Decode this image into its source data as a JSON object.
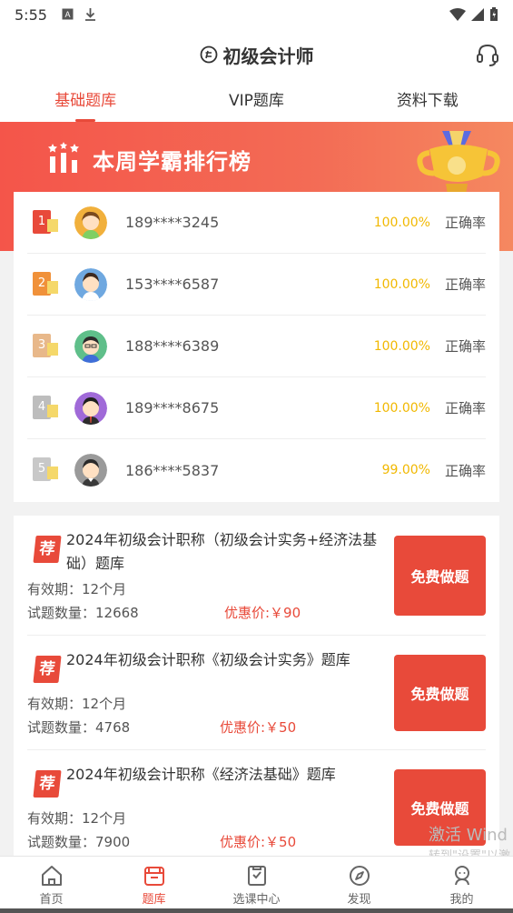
{
  "status": {
    "time": "5:55"
  },
  "header": {
    "title": "初级会计师"
  },
  "tabs": [
    {
      "label": "基础题库"
    },
    {
      "label": "VIP题库"
    },
    {
      "label": "资料下载"
    }
  ],
  "banner": {
    "title": "本周学霸排行榜"
  },
  "leaderboard": [
    {
      "rank": "1",
      "phone": "189****3245",
      "rate": "100.00%",
      "rate_label": "正确率",
      "color": "#e84a3a"
    },
    {
      "rank": "2",
      "phone": "153****6587",
      "rate": "100.00%",
      "rate_label": "正确率",
      "color": "#f0913a"
    },
    {
      "rank": "3",
      "phone": "188****6389",
      "rate": "100.00%",
      "rate_label": "正确率",
      "color": "#e8b88a"
    },
    {
      "rank": "4",
      "phone": "189****8675",
      "rate": "100.00%",
      "rate_label": "正确率",
      "color": "#bdbdbd"
    },
    {
      "rank": "5",
      "phone": "186****5837",
      "rate": "99.00%",
      "rate_label": "正确率",
      "color": "#c8c8c8"
    }
  ],
  "courses": [
    {
      "badge": "荐",
      "title": "2024年初级会计职称（初级会计实务+经济法基础）题库",
      "validity": "有效期：12个月",
      "count": "试题数量：12668",
      "price": "优惠价:￥90",
      "button": "免费做题"
    },
    {
      "badge": "荐",
      "title": "2024年初级会计职称《初级会计实务》题库",
      "validity": "有效期：12个月",
      "count": "试题数量：4768",
      "price": "优惠价:￥50",
      "button": "免费做题"
    },
    {
      "badge": "荐",
      "title": "2024年初级会计职称《经济法基础》题库",
      "validity": "有效期：12个月",
      "count": "试题数量：7900",
      "price": "优惠价:￥50",
      "button": "免费做题"
    }
  ],
  "watermark": {
    "line1": "激活 Wind",
    "line2": "转到\"设置\"以激"
  },
  "nav": [
    {
      "label": "首页"
    },
    {
      "label": "题库"
    },
    {
      "label": "选课中心"
    },
    {
      "label": "发现"
    },
    {
      "label": "我的"
    }
  ]
}
